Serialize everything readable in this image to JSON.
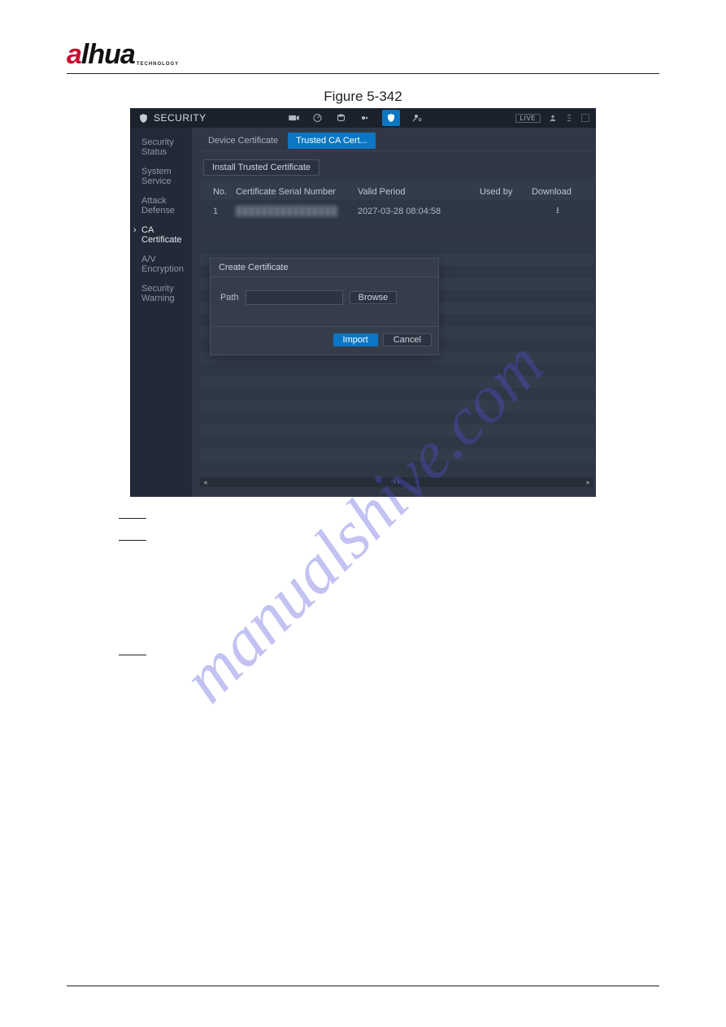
{
  "page_header": {
    "logo_brand_highlight": "a",
    "logo_brand_text": "lhua",
    "logo_subtext": "TECHNOLOGY"
  },
  "figure_caption": "Figure 5-342",
  "watermark_text": "manualshive.com",
  "screenshot": {
    "app_title": "SECURITY",
    "top_live_badge": "LIVE",
    "top_icons": {
      "camera": "camera-icon",
      "gauge": "gauge-icon",
      "disk": "disk-icon",
      "gear": "gear-icon",
      "shield": "shield-icon",
      "user_gear": "user-gear-icon"
    },
    "sidebar": {
      "items": [
        {
          "label": "Security Status"
        },
        {
          "label": "System Service"
        },
        {
          "label": "Attack Defense"
        },
        {
          "label": "CA Certificate"
        },
        {
          "label": "A/V Encryption"
        },
        {
          "label": "Security Warning"
        }
      ],
      "active_index": 3
    },
    "tabs": {
      "items": [
        {
          "label": "Device Certificate"
        },
        {
          "label": "Trusted CA Cert..."
        }
      ],
      "active_index": 1
    },
    "install_button": "Install Trusted Certificate",
    "table": {
      "headers": {
        "no": "No.",
        "serial": "Certificate Serial Number",
        "valid": "Valid Period",
        "used": "Used by",
        "download": "Download",
        "cutoff": "D"
      },
      "rows": [
        {
          "no": "1",
          "serial_blurred": "████████████████",
          "valid": "2027-03-28 08:04:58",
          "used": "",
          "download_icon": "download-icon"
        }
      ]
    },
    "dialog": {
      "title": "Create Certificate",
      "path_label": "Path",
      "path_value": "",
      "browse_button": "Browse",
      "import_button": "Import",
      "cancel_button": "Cancel"
    }
  }
}
